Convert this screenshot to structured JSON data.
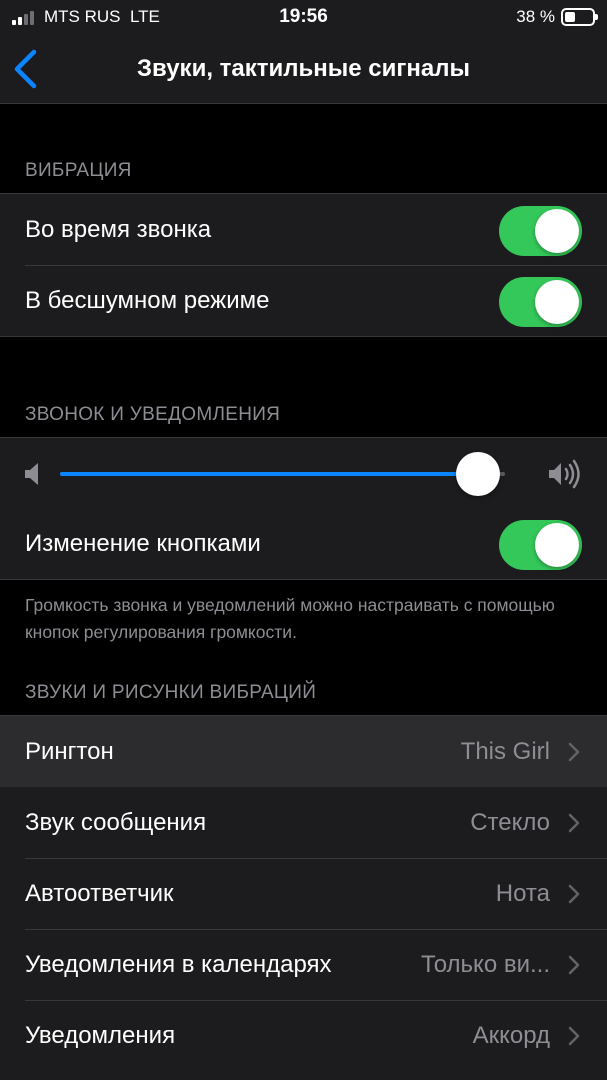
{
  "status_bar": {
    "carrier": "MTS RUS",
    "network": "LTE",
    "time": "19:56",
    "battery_percent": "38 %",
    "battery_level": 0.38,
    "signal_bars": 2
  },
  "nav": {
    "back_icon": "chevron-left-icon",
    "title": "Звуки, тактильные сигналы"
  },
  "vibration": {
    "header": "ВИБРАЦИЯ",
    "rows": [
      {
        "label": "Во время звонка",
        "on": true
      },
      {
        "label": "В бесшумном режиме",
        "on": true
      }
    ]
  },
  "ringer": {
    "header": "ЗВОНОК И УВЕДОМЛЕНИЯ",
    "volume_level": 0.94,
    "low_icon": "speaker-low-icon",
    "high_icon": "speaker-high-icon",
    "buttons_row": {
      "label": "Изменение кнопками",
      "on": true
    },
    "footnote": "Громкость звонка и уведомлений можно настраивать с помощью кнопок регулирования громкости."
  },
  "sounds": {
    "header": "ЗВУКИ И РИСУНКИ ВИБРАЦИЙ",
    "rows": [
      {
        "label": "Рингтон",
        "value": "This Girl"
      },
      {
        "label": "Звук сообщения",
        "value": "Стекло"
      },
      {
        "label": "Автоответчик",
        "value": "Нота"
      },
      {
        "label": "Уведомления в календарях",
        "value": "Только ви..."
      },
      {
        "label": "Уведомления",
        "value": "Аккорд"
      }
    ]
  },
  "colors": {
    "accent_blue": "#0a84ff",
    "toggle_on": "#34c759",
    "background": "#000000",
    "cell_background": "#1c1c1e",
    "secondary_text": "#8d8d93"
  }
}
